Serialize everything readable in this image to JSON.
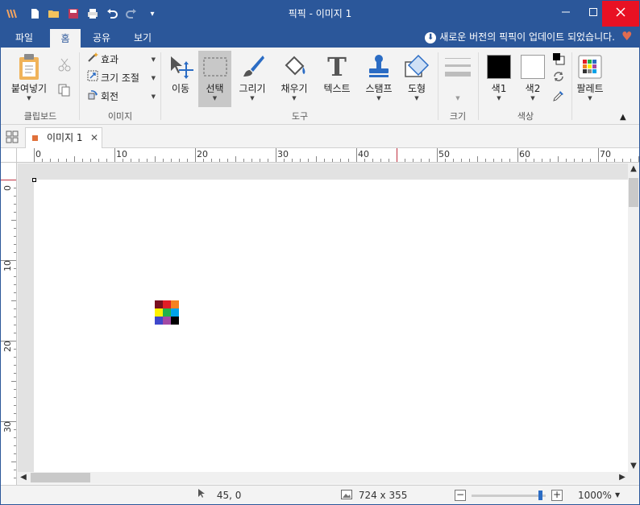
{
  "window": {
    "title": "픽픽 - 이미지 1",
    "minimize_icon": "minimize-icon",
    "maximize_icon": "maximize-icon",
    "close_icon": "close-icon"
  },
  "menu_tabs": [
    {
      "label": "파일",
      "active": false
    },
    {
      "label": "홈",
      "active": true
    },
    {
      "label": "공유",
      "active": false
    },
    {
      "label": "보기",
      "active": false
    }
  ],
  "update_notice": "새로운 버전의 픽픽이 업데이트 되었습니다.",
  "ribbon": {
    "clipboard": {
      "paste_label": "붙여넣기",
      "group_label": "클립보드"
    },
    "image": {
      "effects_label": "효과",
      "resize_label": "크기 조절",
      "rotate_label": "회전",
      "group_label": "이미지"
    },
    "tools": {
      "move_label": "이동",
      "select_label": "선택",
      "draw_label": "그리기",
      "fill_label": "채우기",
      "text_label": "텍스트",
      "stamp_label": "스탬프",
      "shape_label": "도형",
      "group_label": "도구"
    },
    "size": {
      "group_label": "크기"
    },
    "colors": {
      "color1_label": "색1",
      "color2_label": "색2",
      "group_label": "색상",
      "color1": "#000000",
      "color2": "#ffffff"
    },
    "palette_label": "팔레트"
  },
  "document_tab": {
    "label": "이미지 1",
    "accent": "#e0703a"
  },
  "ruler": {
    "horizontal_labels": [
      "0",
      "10",
      "20",
      "30",
      "40",
      "50",
      "60",
      "70"
    ],
    "vertical_labels": [
      "0",
      "10",
      "20",
      "30"
    ]
  },
  "canvas_pixels": [
    [
      "#7a1020",
      "#e21d26",
      "#f58220"
    ],
    [
      "#fff200",
      "#22b14c",
      "#00a2e8"
    ],
    [
      "#3f48cc",
      "#a349a4",
      "#000000"
    ]
  ],
  "status": {
    "cursor_position": "45, 0",
    "image_size": "724 x 355",
    "zoom": "1000%",
    "zoom_fraction": 0.93
  }
}
